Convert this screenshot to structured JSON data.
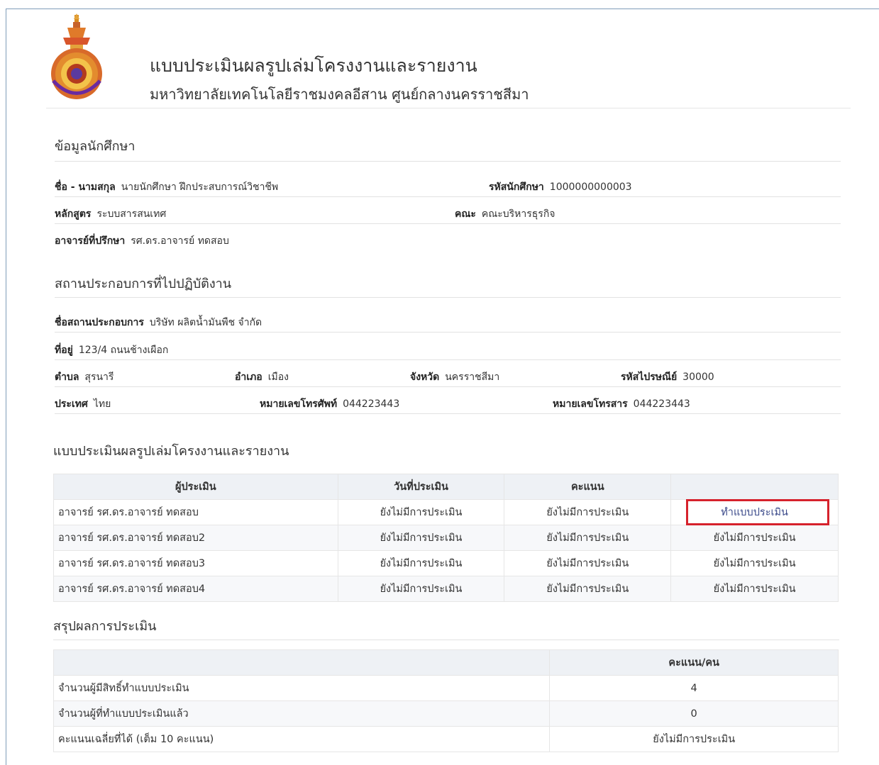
{
  "header": {
    "title": "แบบประเมินผลรูปเล่มโครงงานและรายงาน",
    "subtitle": "มหาวิทยาลัยเทคโนโลยีราชมงคลอีสาน ศูนย์กลางนครราชสีมา"
  },
  "student": {
    "section_title": "ข้อมูลนักศึกษา",
    "name_label": "ชื่อ - นามสกุล",
    "name_value": "นายนักศึกษา ฝึกประสบการณ์วิชาชีพ",
    "id_label": "รหัสนักศึกษา",
    "id_value": "1000000000003",
    "program_label": "หลักสูตร",
    "program_value": "ระบบสารสนเทศ",
    "faculty_label": "คณะ",
    "faculty_value": "คณะบริหารธุรกิจ",
    "advisor_label": "อาจารย์ที่ปรึกษา",
    "advisor_value": "รศ.ดร.อาจารย์ ทดสอบ"
  },
  "workplace": {
    "section_title": "สถานประกอบการที่ไปปฏิบัติงาน",
    "company_label": "ชื่อสถานประกอบการ",
    "company_value": "บริษัท ผลิตน้ำมันพืช จำกัด",
    "address_label": "ที่อยู่",
    "address_value": "123/4 ถนนช้างเผือก",
    "subdistrict_label": "ตำบล",
    "subdistrict_value": "สุรนารี",
    "district_label": "อำเภอ",
    "district_value": "เมือง",
    "province_label": "จังหวัด",
    "province_value": "นครราชสีมา",
    "postal_label": "รหัสไปรษณีย์",
    "postal_value": "30000",
    "country_label": "ประเทศ",
    "country_value": "ไทย",
    "phone_label": "หมายเลขโทรศัพท์",
    "phone_value": "044223443",
    "fax_label": "หมายเลขโทรสาร",
    "fax_value": "044223443"
  },
  "evaluation": {
    "section_title": "แบบประเมินผลรูปเล่มโครงงานและรายงาน",
    "headers": [
      "ผู้ประเมิน",
      "วันที่ประเมิน",
      "คะแนน",
      ""
    ],
    "rows": [
      {
        "evaluator": "อาจารย์ รศ.ดร.อาจารย์ ทดสอบ",
        "date": "ยังไม่มีการประเมิน",
        "score": "ยังไม่มีการประเมิน",
        "action": "ทำแบบประเมิน"
      },
      {
        "evaluator": "อาจารย์ รศ.ดร.อาจารย์ ทดสอบ2",
        "date": "ยังไม่มีการประเมิน",
        "score": "ยังไม่มีการประเมิน",
        "action": "ยังไม่มีการประเมิน"
      },
      {
        "evaluator": "อาจารย์ รศ.ดร.อาจารย์ ทดสอบ3",
        "date": "ยังไม่มีการประเมิน",
        "score": "ยังไม่มีการประเมิน",
        "action": "ยังไม่มีการประเมิน"
      },
      {
        "evaluator": "อาจารย์ รศ.ดร.อาจารย์ ทดสอบ4",
        "date": "ยังไม่มีการประเมิน",
        "score": "ยังไม่มีการประเมิน",
        "action": "ยังไม่มีการประเมิน"
      }
    ]
  },
  "summary": {
    "section_title": "สรุปผลการประเมิน",
    "headers": [
      "",
      "คะแนน/คน"
    ],
    "rows": [
      {
        "label": "จำนวนผู้มีสิทธิ์ทำแบบประเมิน",
        "value": "4"
      },
      {
        "label": "จำนวนผู้ที่ทำแบบประเมินแล้ว",
        "value": "0"
      },
      {
        "label": "คะแนนเฉลี่ยที่ได้ (เต็ม 10 คะแนน)",
        "value": "ยังไม่มีการประเมิน"
      }
    ]
  },
  "colors": {
    "highlight": "#d6222c",
    "header_bg": "#eef1f5",
    "link": "#3b4a8a"
  }
}
